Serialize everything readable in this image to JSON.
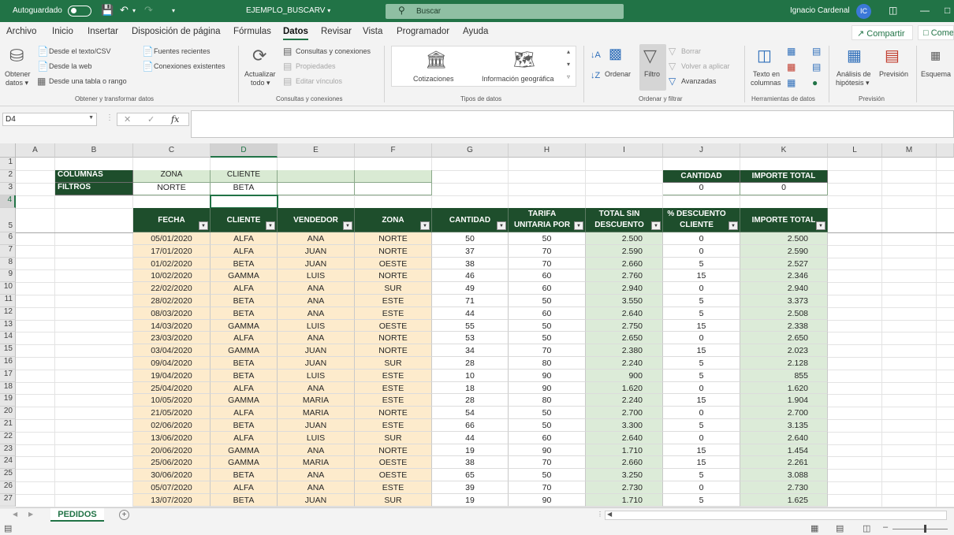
{
  "titlebar": {
    "autosave_label": "Autoguardado",
    "doc_title": "EJEMPLO_BUSCARV",
    "doc_title_caret": "▾",
    "search_placeholder": "Buscar",
    "user_name": "Ignacio Cardenal",
    "avatar_initials": "IC"
  },
  "menu": {
    "tabs": [
      "Archivo",
      "Inicio",
      "Insertar",
      "Disposición de página",
      "Fórmulas",
      "Datos",
      "Revisar",
      "Vista",
      "Programador",
      "Ayuda"
    ],
    "active_tab": "Datos",
    "share_label": "Compartir",
    "comments_label": "Comentarios"
  },
  "ribbon": {
    "obtener_datos_1": "Obtener",
    "obtener_datos_2": "datos ▾",
    "desde_texto": "Desde el texto/CSV",
    "desde_web": "Desde la web",
    "desde_tabla": "Desde una tabla o rango",
    "fuentes_recientes": "Fuentes recientes",
    "conexiones_existentes": "Conexiones existentes",
    "group_obtener": "Obtener y transformar datos",
    "actualizar_1": "Actualizar",
    "actualizar_2": "todo ▾",
    "consultas_conexiones": "Consultas y conexiones",
    "propiedades": "Propiedades",
    "editar_vinculos": "Editar vínculos",
    "group_consultas": "Consultas y conexiones",
    "cotizaciones": "Cotizaciones",
    "info_geografica": "Información geográfica",
    "group_tipos": "Tipos de datos",
    "ordenar": "Ordenar",
    "filtro": "Filtro",
    "borrar": "Borrar",
    "volver_aplicar": "Volver a aplicar",
    "avanzadas": "Avanzadas",
    "group_ordenar": "Ordenar y filtrar",
    "texto_columnas_1": "Texto en",
    "texto_columnas_2": "columnas",
    "group_herramientas": "Herramientas de datos",
    "analisis_1": "Análisis de",
    "analisis_2": "hipótesis ▾",
    "prevision_btn": "Previsión",
    "group_prevision": "Previsión",
    "esquema": "Esquema"
  },
  "formula_bar": {
    "name_box": "D4",
    "fx": "fx",
    "value": ""
  },
  "columns": [
    "A",
    "B",
    "C",
    "D",
    "E",
    "F",
    "G",
    "H",
    "I",
    "J",
    "K",
    "L",
    "M"
  ],
  "selected_column": "D",
  "row_numbers": [
    "1",
    "2",
    "3",
    "4",
    "5",
    "6",
    "7",
    "8",
    "9",
    "10",
    "11",
    "12",
    "13",
    "14",
    "15",
    "16",
    "17",
    "18",
    "19",
    "20",
    "21",
    "22",
    "23",
    "24",
    "25",
    "26",
    "27"
  ],
  "selected_row": "4",
  "criteria": {
    "row_label_columns": "COLUMNAS",
    "row_label_filters": "FILTROS",
    "col_zona": "ZONA",
    "col_cliente": "CLIENTE",
    "val_zona": "NORTE",
    "val_cliente": "BETA"
  },
  "summary": {
    "cantidad_header": "CANTIDAD",
    "importe_header": "IMPORTE TOTAL",
    "cantidad_value": "0",
    "importe_value": "0"
  },
  "table": {
    "headers": [
      "FECHA",
      "CLIENTE",
      "VENDEDOR",
      "ZONA",
      "CANTIDAD",
      "TARIFA UNITARIA POR CANTIDAD",
      "TOTAL SIN DESCUENTO",
      "% DESCUENTO CLIENTE",
      "IMPORTE TOTAL"
    ],
    "rows": [
      [
        "05/01/2020",
        "ALFA",
        "ANA",
        "NORTE",
        "50",
        "50",
        "2.500",
        "0",
        "2.500"
      ],
      [
        "17/01/2020",
        "ALFA",
        "JUAN",
        "NORTE",
        "37",
        "70",
        "2.590",
        "0",
        "2.590"
      ],
      [
        "01/02/2020",
        "BETA",
        "JUAN",
        "OESTE",
        "38",
        "70",
        "2.660",
        "5",
        "2.527"
      ],
      [
        "10/02/2020",
        "GAMMA",
        "LUIS",
        "NORTE",
        "46",
        "60",
        "2.760",
        "15",
        "2.346"
      ],
      [
        "22/02/2020",
        "ALFA",
        "ANA",
        "SUR",
        "49",
        "60",
        "2.940",
        "0",
        "2.940"
      ],
      [
        "28/02/2020",
        "BETA",
        "ANA",
        "ESTE",
        "71",
        "50",
        "3.550",
        "5",
        "3.373"
      ],
      [
        "08/03/2020",
        "BETA",
        "ANA",
        "ESTE",
        "44",
        "60",
        "2.640",
        "5",
        "2.508"
      ],
      [
        "14/03/2020",
        "GAMMA",
        "LUIS",
        "OESTE",
        "55",
        "50",
        "2.750",
        "15",
        "2.338"
      ],
      [
        "23/03/2020",
        "ALFA",
        "ANA",
        "NORTE",
        "53",
        "50",
        "2.650",
        "0",
        "2.650"
      ],
      [
        "03/04/2020",
        "GAMMA",
        "JUAN",
        "NORTE",
        "34",
        "70",
        "2.380",
        "15",
        "2.023"
      ],
      [
        "09/04/2020",
        "BETA",
        "JUAN",
        "SUR",
        "28",
        "80",
        "2.240",
        "5",
        "2.128"
      ],
      [
        "19/04/2020",
        "BETA",
        "LUIS",
        "ESTE",
        "10",
        "90",
        "900",
        "5",
        "855"
      ],
      [
        "25/04/2020",
        "ALFA",
        "ANA",
        "ESTE",
        "18",
        "90",
        "1.620",
        "0",
        "1.620"
      ],
      [
        "10/05/2020",
        "GAMMA",
        "MARIA",
        "ESTE",
        "28",
        "80",
        "2.240",
        "15",
        "1.904"
      ],
      [
        "21/05/2020",
        "ALFA",
        "MARIA",
        "NORTE",
        "54",
        "50",
        "2.700",
        "0",
        "2.700"
      ],
      [
        "02/06/2020",
        "BETA",
        "JUAN",
        "ESTE",
        "66",
        "50",
        "3.300",
        "5",
        "3.135"
      ],
      [
        "13/06/2020",
        "ALFA",
        "LUIS",
        "SUR",
        "44",
        "60",
        "2.640",
        "0",
        "2.640"
      ],
      [
        "20/06/2020",
        "GAMMA",
        "ANA",
        "NORTE",
        "19",
        "90",
        "1.710",
        "15",
        "1.454"
      ],
      [
        "25/06/2020",
        "GAMMA",
        "MARIA",
        "OESTE",
        "38",
        "70",
        "2.660",
        "15",
        "2.261"
      ],
      [
        "30/06/2020",
        "BETA",
        "ANA",
        "OESTE",
        "65",
        "50",
        "3.250",
        "5",
        "3.088"
      ],
      [
        "05/07/2020",
        "ALFA",
        "ANA",
        "ESTE",
        "39",
        "70",
        "2.730",
        "0",
        "2.730"
      ],
      [
        "13/07/2020",
        "BETA",
        "JUAN",
        "SUR",
        "19",
        "90",
        "1.710",
        "5",
        "1.625"
      ]
    ]
  },
  "sheet_tab": "PEDIDOS"
}
